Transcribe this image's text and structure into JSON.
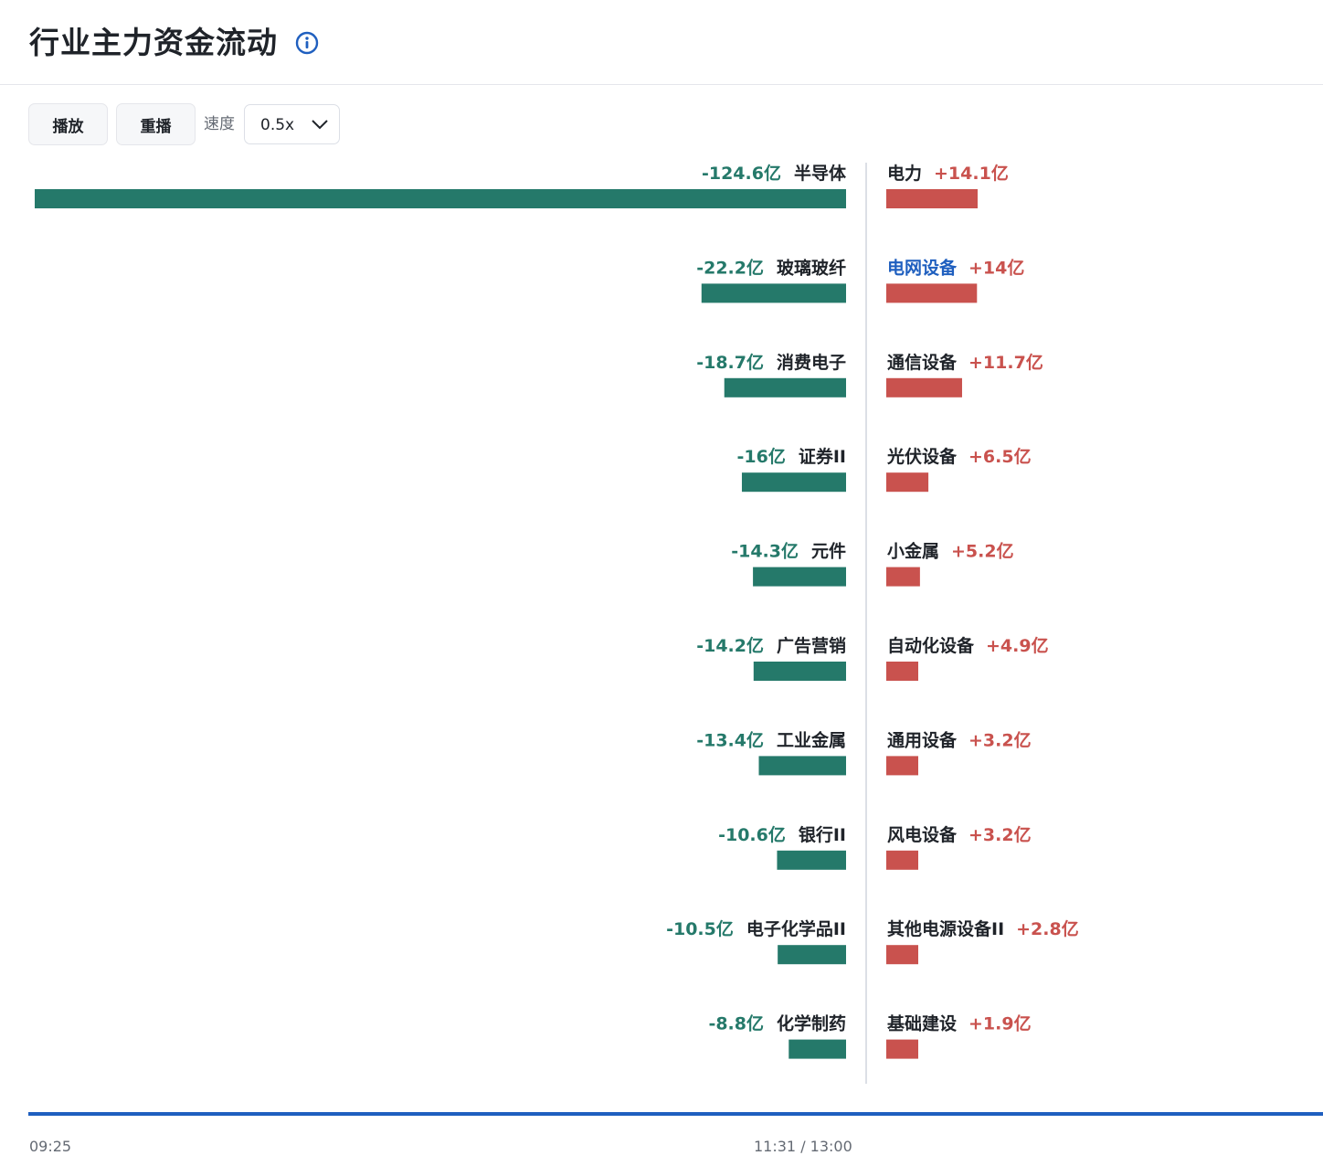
{
  "header": {
    "title": "行业主力资金流动",
    "info_icon": "info-circle-icon"
  },
  "toolbar": {
    "play_label": "播放",
    "replay_label": "重播",
    "speed_label": "速度",
    "speed_value": "0.5x"
  },
  "colors": {
    "outflow": "#25796a",
    "inflow": "#c9524e",
    "highlight_label": "#1f5fbf",
    "timeline": "#1f5fbf"
  },
  "chart_data": {
    "type": "bar",
    "units": "亿",
    "outflow": [
      {
        "name": "半导体",
        "value": -124.6,
        "label": "-124.6亿"
      },
      {
        "name": "玻璃玻纤",
        "value": -22.2,
        "label": "-22.2亿"
      },
      {
        "name": "消费电子",
        "value": -18.7,
        "label": "-18.7亿"
      },
      {
        "name": "证券II",
        "value": -16,
        "label": "-16亿"
      },
      {
        "name": "元件",
        "value": -14.3,
        "label": "-14.3亿"
      },
      {
        "name": "广告营销",
        "value": -14.2,
        "label": "-14.2亿"
      },
      {
        "name": "工业金属",
        "value": -13.4,
        "label": "-13.4亿"
      },
      {
        "name": "银行II",
        "value": -10.6,
        "label": "-10.6亿"
      },
      {
        "name": "电子化学品II",
        "value": -10.5,
        "label": "-10.5亿"
      },
      {
        "name": "化学制药",
        "value": -8.8,
        "label": "-8.8亿"
      }
    ],
    "inflow": [
      {
        "name": "电力",
        "value": 14.1,
        "label": "+14.1亿"
      },
      {
        "name": "电网设备",
        "value": 14,
        "label": "+14亿",
        "highlighted": true
      },
      {
        "name": "通信设备",
        "value": 11.7,
        "label": "+11.7亿"
      },
      {
        "name": "光伏设备",
        "value": 6.5,
        "label": "+6.5亿"
      },
      {
        "name": "小金属",
        "value": 5.2,
        "label": "+5.2亿"
      },
      {
        "name": "自动化设备",
        "value": 4.9,
        "label": "+4.9亿"
      },
      {
        "name": "通用设备",
        "value": 3.2,
        "label": "+3.2亿"
      },
      {
        "name": "风电设备",
        "value": 3.2,
        "label": "+3.2亿"
      },
      {
        "name": "其他电源设备II",
        "value": 2.8,
        "label": "+2.8亿"
      },
      {
        "name": "基础建设",
        "value": 1.9,
        "label": "+1.9亿"
      }
    ]
  },
  "timeline": {
    "start": "09:25",
    "current": "11:31 / 13:00",
    "progress": 1.0
  }
}
